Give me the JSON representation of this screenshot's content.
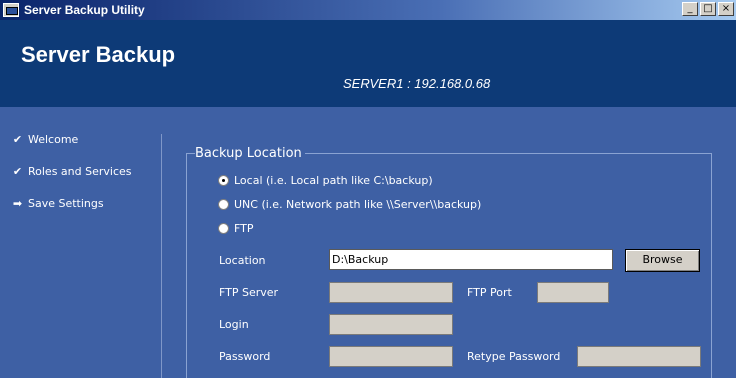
{
  "window": {
    "title": "Server Backup Utility",
    "controls": {
      "minimize": "_",
      "maximize": "□",
      "close": "×"
    }
  },
  "header": {
    "title": "Server Backup",
    "server": "SERVER1 : 192.168.0.68"
  },
  "sidebar": {
    "items": [
      {
        "label": "Welcome",
        "icon": "check-icon",
        "glyph": "✔"
      },
      {
        "label": "Roles and Services",
        "icon": "check-icon",
        "glyph": "✔"
      },
      {
        "label": "Save Settings",
        "icon": "arrow-right-icon",
        "glyph": "➡"
      }
    ]
  },
  "backup_location": {
    "group_title": "Backup Location",
    "options": [
      {
        "label": "Local (i.e. Local path like C:\\backup)",
        "selected": true
      },
      {
        "label": "UNC (i.e. Network path like \\\\Server\\\\backup)",
        "selected": false
      },
      {
        "label": "FTP",
        "selected": false
      }
    ],
    "location_label": "Location",
    "location_value": "D:\\Backup",
    "browse_label": "Browse",
    "ftp_server_label": "FTP Server",
    "ftp_server_value": "",
    "ftp_port_label": "FTP Port",
    "ftp_port_value": "",
    "login_label": "Login",
    "login_value": "",
    "password_label": "Password",
    "password_value": "",
    "retype_password_label": "Retype Password",
    "retype_password_value": ""
  },
  "colors": {
    "header_bg": "#0d3a77",
    "body_bg": "#3e60a4",
    "disabled_field": "#d4d0c8"
  }
}
